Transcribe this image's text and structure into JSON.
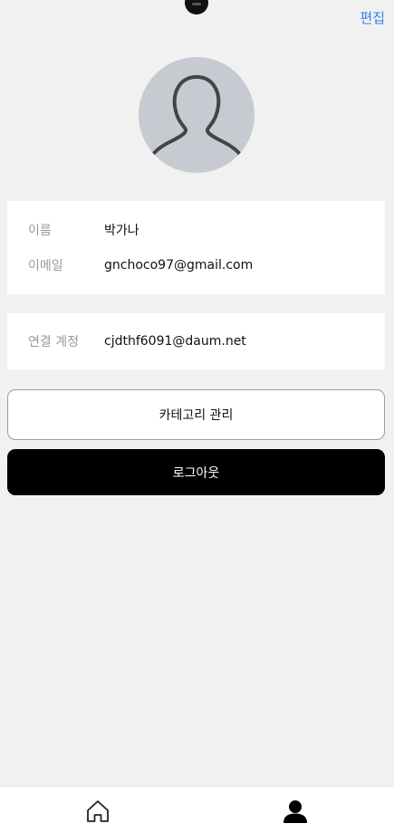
{
  "header": {
    "edit_label": "편집"
  },
  "profile": {
    "avatar_icon": "default-user-avatar-icon",
    "fields": [
      {
        "label": "이름",
        "value": "박가나"
      },
      {
        "label": "이메일",
        "value": "gnchoco97@gmail.com"
      }
    ]
  },
  "linked_account": {
    "label": "연결 계정",
    "value": "cjdthf6091@daum.net"
  },
  "actions": {
    "category_label": "카테고리 관리",
    "logout_label": "로그아웃"
  },
  "bottom_nav": {
    "items": [
      {
        "icon": "home-icon"
      },
      {
        "icon": "person-icon"
      }
    ]
  },
  "colors": {
    "background": "#f1f1f1",
    "accent": "#2f80ed",
    "avatar_bg": "#c7cbd1",
    "logout_bg": "#000000"
  }
}
